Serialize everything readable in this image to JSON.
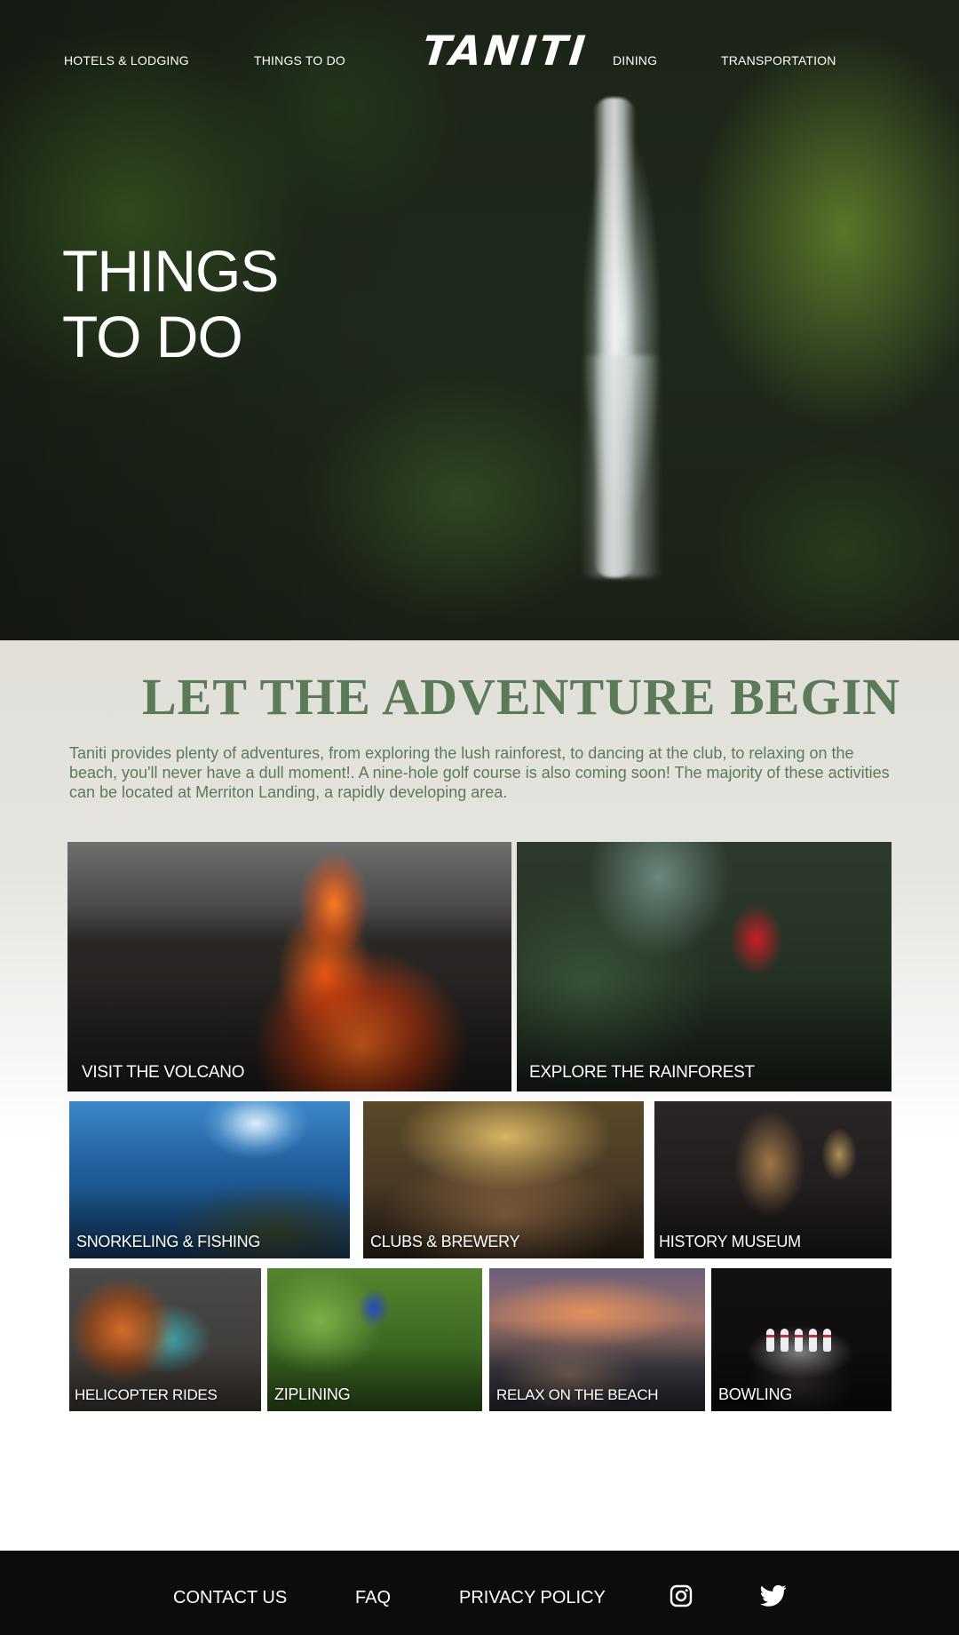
{
  "nav": {
    "hotels": "HOTELS & LODGING",
    "things": "THINGS TO DO",
    "logo": "TANITI",
    "dining": "DINING",
    "transport": "TRANSPORTATION"
  },
  "hero": {
    "title_line1": "THINGS",
    "title_line2": "TO DO"
  },
  "main": {
    "headline": "LET THE ADVENTURE BEGIN",
    "intro": "Taniti provides plenty of adventures, from exploring the lush rainforest, to dancing at the club, to relaxing on the beach, you'll never have a dull moment!. A nine-hole golf course is also coming soon! The majority of these activities can be located at Merriton Landing, a rapidly developing area."
  },
  "tiles": [
    {
      "label": "VISIT THE VOLCANO"
    },
    {
      "label": "EXPLORE THE RAINFOREST"
    },
    {
      "label": "SNORKELING & FISHING"
    },
    {
      "label": "CLUBS & BREWERY"
    },
    {
      "label": "HISTORY MUSEUM"
    },
    {
      "label": "HELICOPTER RIDES"
    },
    {
      "label": "ZIPLINING"
    },
    {
      "label": "RELAX ON THE BEACH"
    },
    {
      "label": "BOWLING"
    }
  ],
  "footer": {
    "contact": "CONTACT US",
    "faq": "FAQ",
    "privacy": "PRIVACY POLICY",
    "icons": [
      "instagram-icon",
      "twitter-icon"
    ]
  },
  "colors": {
    "accent_green": "#5b7b58",
    "footer_bg": "#0a0d09"
  }
}
